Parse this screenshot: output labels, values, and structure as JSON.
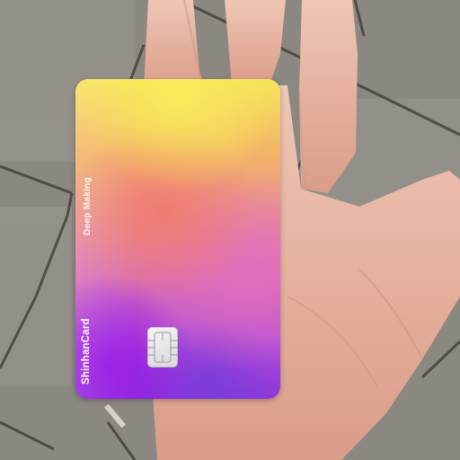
{
  "card": {
    "product_name": "Deep Making",
    "brand": "ShinhanCard"
  },
  "icons": {
    "chip": "emv-chip-icon"
  },
  "colors": {
    "card_top": "#f7e45b",
    "card_middle": "#e98f93",
    "card_bottom": "#8f35d8",
    "pavement": "#8a8680",
    "skin": "#e8b6a3"
  }
}
